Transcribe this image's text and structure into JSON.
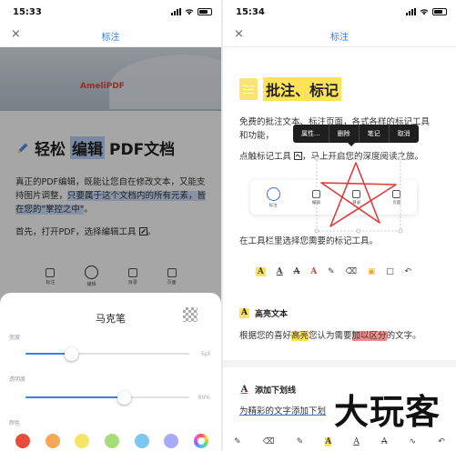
{
  "left": {
    "status": {
      "time": "15:33"
    },
    "nav": {
      "close": "×",
      "title": "标注"
    },
    "banner": {
      "logo": "AmeliPDF"
    },
    "heading": {
      "pre": "轻松",
      "highlight": "编辑",
      "post": "PDF文档"
    },
    "para1": {
      "a": "真正的PDF编辑，既能让您自在修改文本，又能支持图片调整，",
      "b": "只要属于这个文档内的所有元素，皆在您的\"掌控之中\"",
      "c": "。"
    },
    "para2": "首先，打开PDF，选择编辑工具",
    "para2_end": "。",
    "toolbar": [
      {
        "label": "标注",
        "active": false
      },
      {
        "label": "编辑",
        "active": true
      },
      {
        "label": "目录",
        "active": false
      },
      {
        "label": "页面",
        "active": false
      }
    ],
    "sheet": {
      "title": "马克笔",
      "width_label": "宽度",
      "width_value": "6pt",
      "width_level": 0.28,
      "opacity_label": "透明度",
      "opacity_value": "60%",
      "opacity_level": 0.6,
      "color_label": "颜色",
      "colors": [
        "#e84a3c",
        "#f6a85a",
        "#f6e36a",
        "#a5de79",
        "#7cc7f2",
        "#a9aaf6"
      ]
    }
  },
  "right": {
    "status": {
      "time": "15:34"
    },
    "nav": {
      "close": "×",
      "title": "标注"
    },
    "heading": "批注、标记",
    "para1": "免费的批注文本、标注页面，各式各样的标记工具和功能，",
    "para2": "点触标记工具",
    "para2_b": "，马上开启您的深度阅读之旅。",
    "context_menu": [
      "属性...",
      "删除",
      "笔记",
      "取消"
    ],
    "inner_toolbar": [
      {
        "label": "标注",
        "active": true
      },
      {
        "label": "编辑",
        "active": false
      },
      {
        "label": "目录",
        "active": false
      },
      {
        "label": "页面",
        "active": false
      }
    ],
    "para3": "在工具栏里选择您需要的标记工具。",
    "tool_row": [
      "A",
      "A",
      "A",
      "A",
      "✎",
      "⌫",
      "▣",
      "□",
      "↶"
    ],
    "section1": {
      "icon": "A",
      "title": "高亮文本"
    },
    "para4": {
      "a": "根据您的喜好",
      "b": "高亮",
      "c": "您认为需要",
      "d": "加以区分",
      "e": "的文字。"
    },
    "section2": {
      "icon": "A",
      "title": "添加下划线"
    },
    "para5": "为精彩的文字添加下划",
    "bottom_tools": [
      "✎",
      "⌫",
      "✎",
      "A",
      "A",
      "A",
      "∿",
      "↶"
    ],
    "watermark": "大玩客"
  }
}
